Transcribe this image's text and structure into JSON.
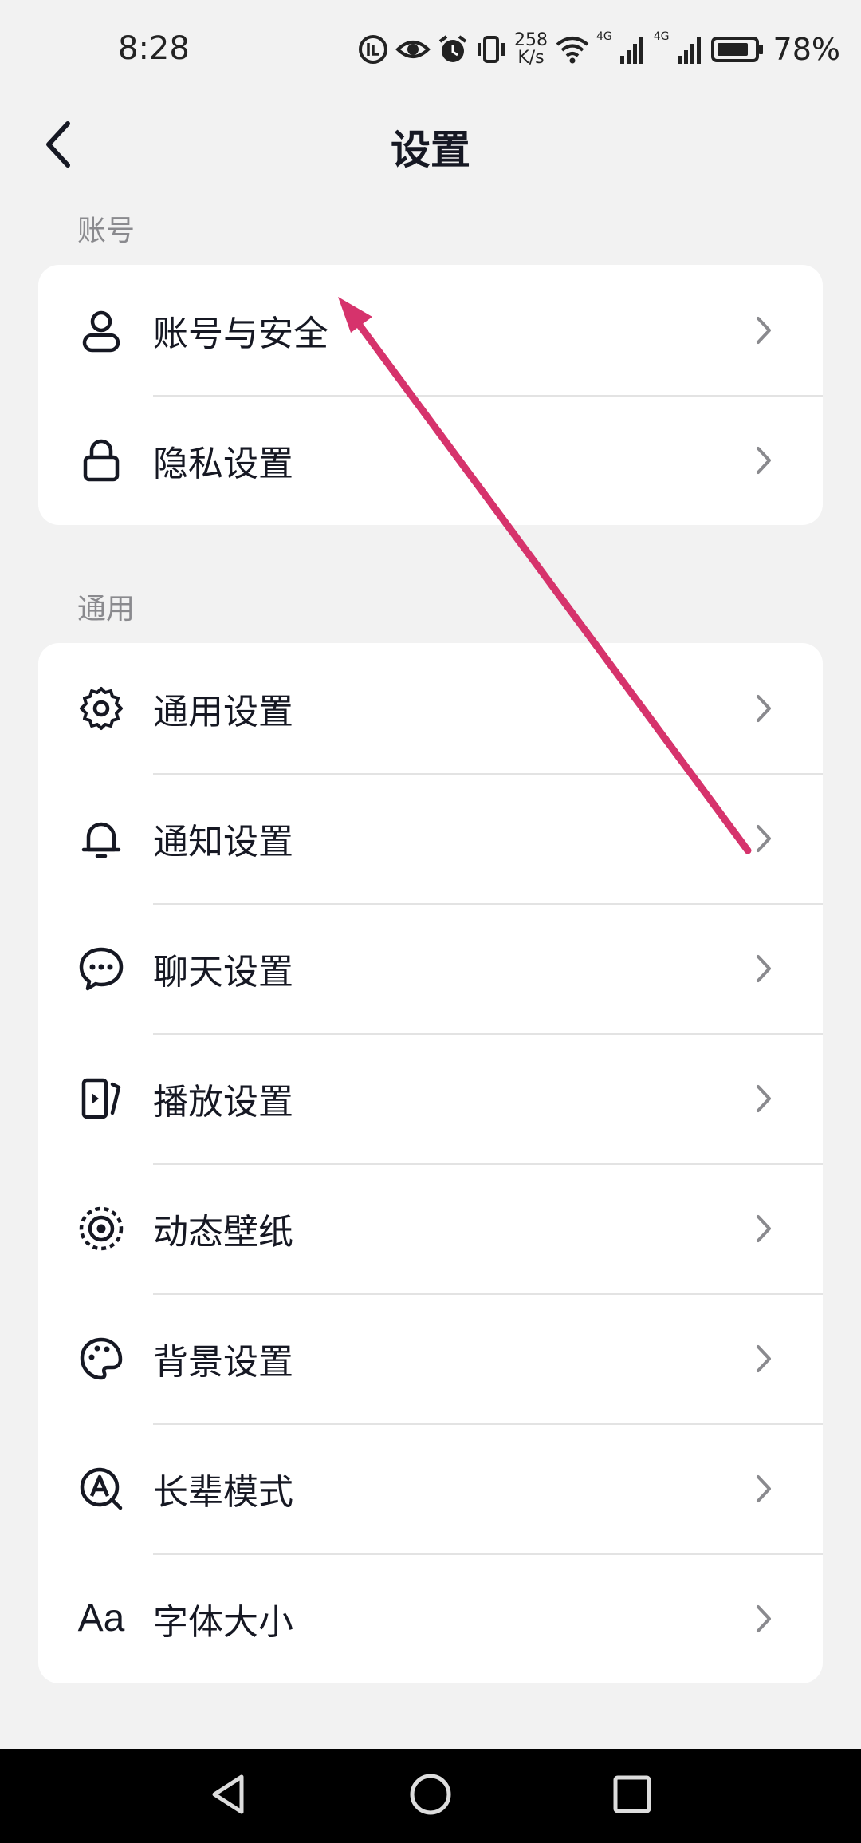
{
  "status_bar": {
    "time": "8:28",
    "net_speed_value": "258",
    "net_speed_unit": "K/s",
    "network_label_1": "4G",
    "network_label_2": "4G",
    "battery": "78%"
  },
  "header": {
    "title": "设置"
  },
  "sections": {
    "account": {
      "label": "账号",
      "items": [
        {
          "label": "账号与安全",
          "icon": "person-icon"
        },
        {
          "label": "隐私设置",
          "icon": "lock-icon"
        }
      ]
    },
    "general": {
      "label": "通用",
      "items": [
        {
          "label": "通用设置",
          "icon": "gear-icon"
        },
        {
          "label": "通知设置",
          "icon": "bell-icon"
        },
        {
          "label": "聊天设置",
          "icon": "chat-bubble-icon"
        },
        {
          "label": "播放设置",
          "icon": "play-screen-icon"
        },
        {
          "label": "动态壁纸",
          "icon": "live-wallpaper-icon"
        },
        {
          "label": "背景设置",
          "icon": "palette-icon"
        },
        {
          "label": "长辈模式",
          "icon": "elder-mode-icon"
        },
        {
          "label": "字体大小",
          "icon": "font-size-icon",
          "icon_text": "Aa"
        }
      ]
    }
  },
  "annotation": {
    "arrow_color": "#d6336c"
  },
  "colors": {
    "background": "#f2f2f2",
    "card": "#ffffff",
    "text_primary": "#161823",
    "text_secondary": "#8a8a8e"
  }
}
